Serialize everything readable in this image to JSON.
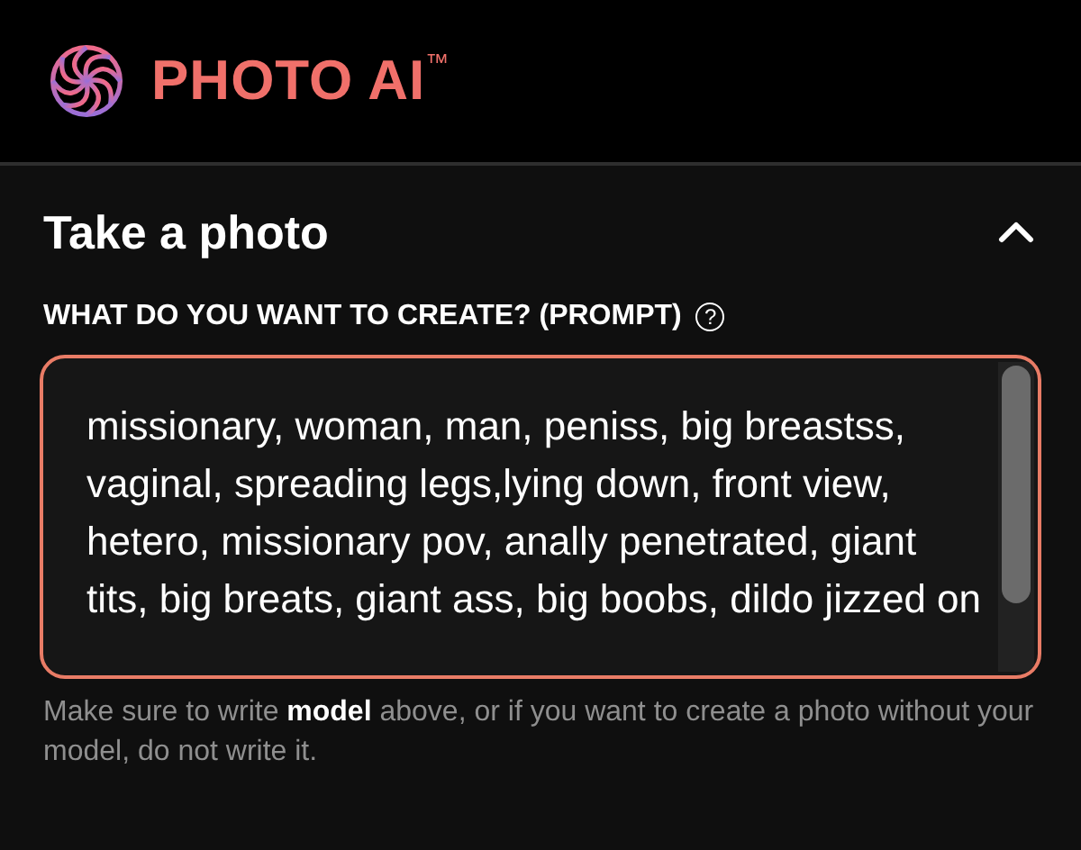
{
  "header": {
    "logo_text": "PHOTO AI$^{™}$"
  },
  "section": {
    "title": "Take a photo",
    "expanded": true
  },
  "prompt": {
    "label": "WHAT DO YOU WANT TO CREATE? (PROMPT)",
    "help": "?",
    "value": "missionary, woman, man, peniss, big breastss, vaginal, spreading legs,lying down, front view, hetero, missionary pov, anally penetrated, giant tits, big breats, giant ass, big boobs, dildo jizzed on",
    "hint": "Make sure to write **model** above, or if you want to create a photo without your model, do not write it."
  }
}
